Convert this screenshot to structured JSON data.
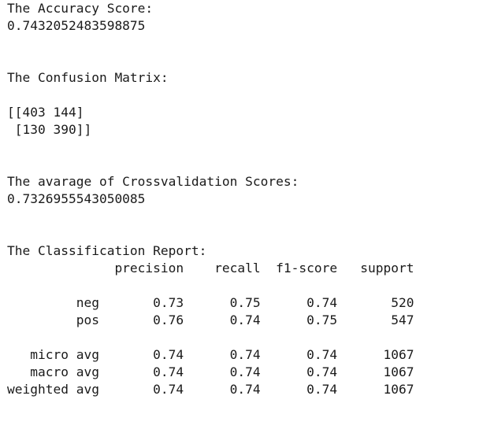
{
  "output_lines": [
    "The Accuracy Score:",
    "0.7432052483598875",
    "",
    "",
    "The Confusion Matrix:",
    "",
    "[[403 144]",
    " [130 390]]",
    "",
    "",
    "The avarage of Crossvalidation Scores:",
    "0.7326955543050085",
    "",
    "",
    "The Classification Report:",
    "              precision    recall  f1-score   support",
    "",
    "         neg       0.73      0.75      0.74       520",
    "         pos       0.76      0.74      0.75       547",
    "",
    "   micro avg       0.74      0.74      0.74      1067",
    "   macro avg       0.74      0.74      0.74      1067",
    "weighted avg       0.74      0.74      0.74      1067"
  ]
}
